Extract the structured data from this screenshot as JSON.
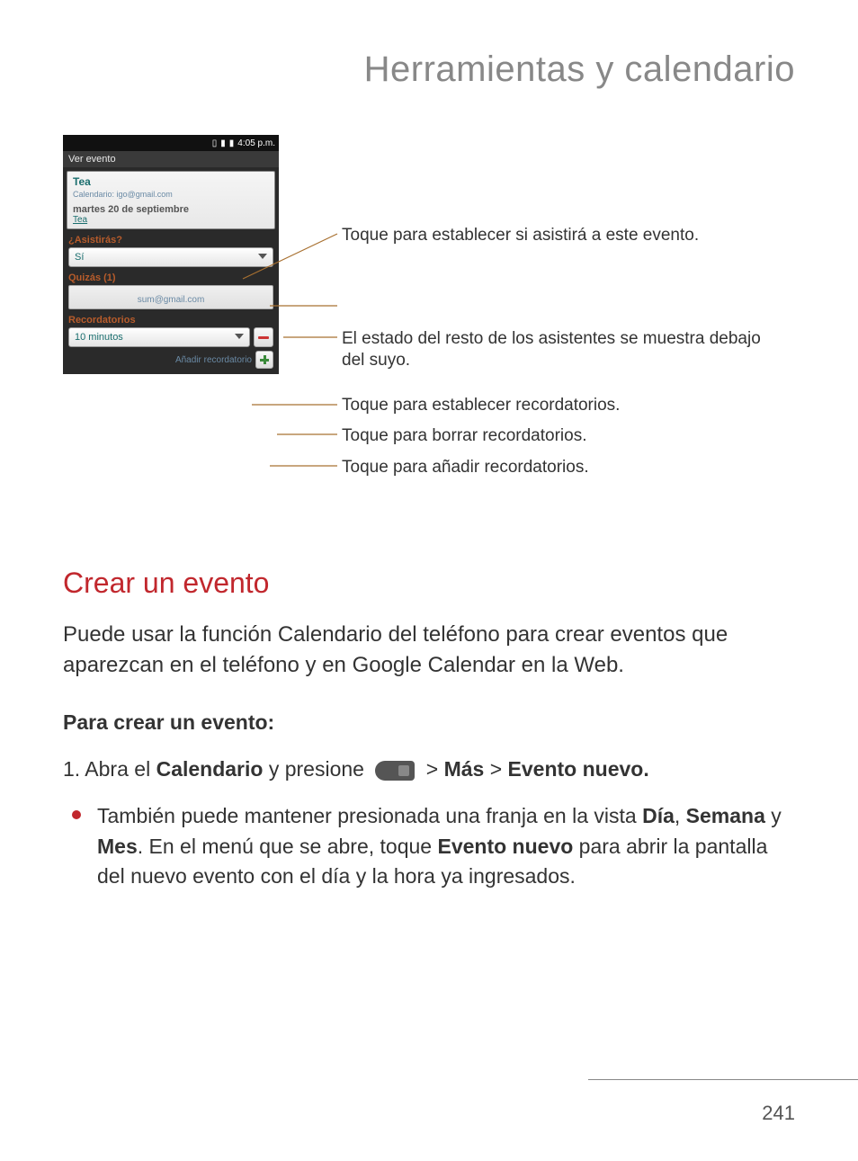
{
  "page_title": "Herramientas y calendario",
  "phone": {
    "time": "4:05 p.m.",
    "status_icons": [
      "3g-icon",
      "signal-icon",
      "battery-icon"
    ],
    "app_title": "Ver evento",
    "event_name": "Tea",
    "calendar_label": "Calendario:",
    "calendar_value": "igo@gmail.com",
    "date_line": "martes 20 de septiembre",
    "date_sub": "Tea",
    "attend_label": "¿Asistirás?",
    "attend_value": "Sí",
    "guests_label": "Quizás (1)",
    "guest_email": "sum@gmail.com",
    "reminders_label": "Recordatorios",
    "reminder_value": "10 minutos",
    "add_reminder_label": "Añadir recordatorio"
  },
  "callouts": {
    "c1": "Toque para establecer si asistirá a este evento.",
    "c2": "El estado del resto de los asistentes se muestra debajo del suyo.",
    "c3": "Toque para establecer recordatorios.",
    "c4": "Toque para borrar recordatorios.",
    "c5": "Toque para añadir recordatorios."
  },
  "section_heading": "Crear un evento",
  "body_text": "Puede usar la función Calendario del teléfono para crear eventos que aparezcan en el teléfono y en Google Calendar en la Web.",
  "sub_heading": "Para crear un evento:",
  "step1": {
    "prefix": "1. Abra el ",
    "app": "Calendario",
    "mid": " y presione ",
    "gt1": " > ",
    "m1": "Más",
    "gt2": " > ",
    "m2": "Evento nuevo."
  },
  "bullet": {
    "p1": "También puede mantener presionada una franja en la vista ",
    "b1": "Día",
    "c1": ", ",
    "b2": "Semana",
    "c2": " y ",
    "b3": "Mes",
    "p2": ". En el menú que se abre, toque ",
    "b4": "Evento nuevo",
    "p3": " para abrir la pantalla del nuevo evento con el día y la hora ya ingresados."
  },
  "page_number": "241"
}
